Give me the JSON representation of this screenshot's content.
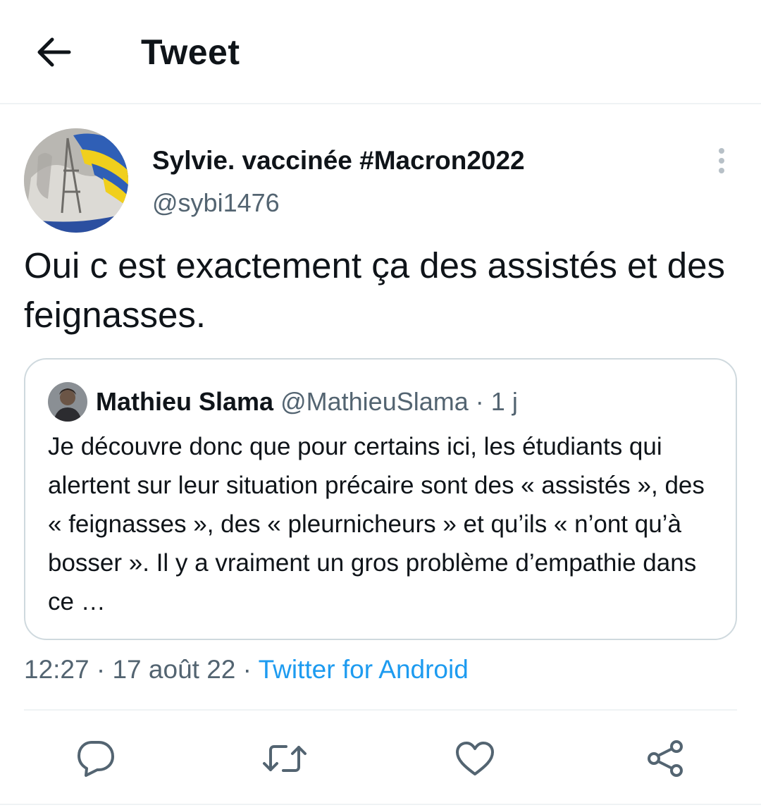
{
  "header": {
    "title": "Tweet",
    "back_icon": "arrow-left-icon"
  },
  "tweet": {
    "author_name": "Sylvie. vaccinée #Macron2022",
    "author_handle": "@sybi1476",
    "text": "Oui c est exactement ça des assistés et des feignasses.",
    "time": "12:27",
    "date": "17 août 22",
    "source": "Twitter for Android",
    "separator": "·"
  },
  "quoted_tweet": {
    "author_name": "Mathieu Slama",
    "author_handle": "@MathieuSlama",
    "separator": "·",
    "time": "1 j",
    "text": "Je découvre donc que pour certains ici, les étudiants qui alertent sur leur situation précaire sont des « assistés », des « feignasses », des « pleurnicheurs » et qu’ils « n’ont qu’à bosser ». Il y a vraiment un gros problème d’empathie dans ce …"
  },
  "actions": [
    {
      "icon": "reply-icon"
    },
    {
      "icon": "retweet-icon"
    },
    {
      "icon": "like-heart-icon"
    },
    {
      "icon": "share-icon"
    }
  ],
  "colors": {
    "text": "#0f1419",
    "secondary": "#536471",
    "link": "#1d9bf0",
    "border": "#cfd9de",
    "divider": "#eff3f4"
  }
}
